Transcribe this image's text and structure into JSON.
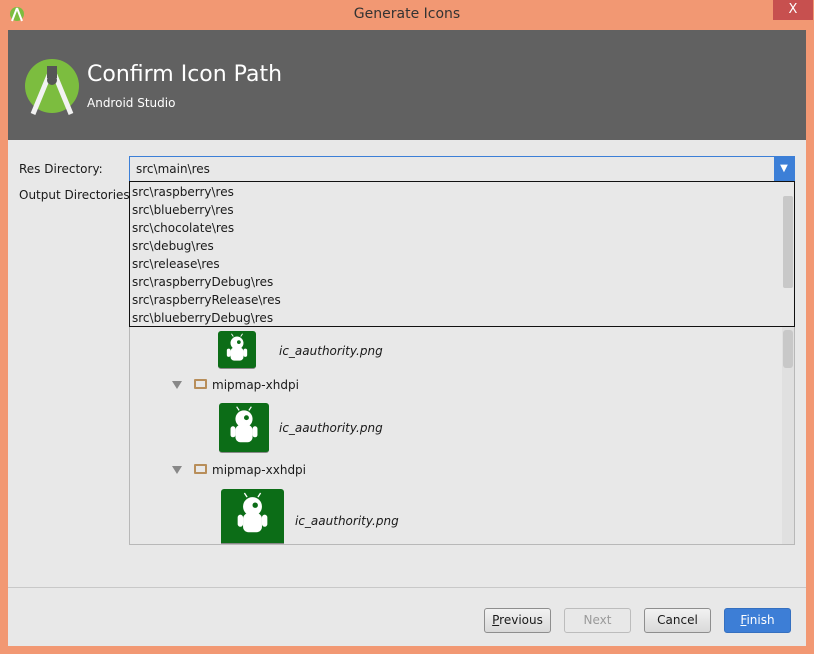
{
  "window": {
    "title": "Generate Icons",
    "close_label": "X"
  },
  "header": {
    "title": "Confirm Icon Path",
    "subtitle": "Android Studio"
  },
  "form": {
    "res_directory_label": "Res Directory:",
    "res_directory_value": "src\\main\\res",
    "output_directories_label": "Output Directories:"
  },
  "dropdown_options": [
    "src\\raspberry\\res",
    "src\\blueberry\\res",
    "src\\chocolate\\res",
    "src\\debug\\res",
    "src\\release\\res",
    "src\\raspberryDebug\\res",
    "src\\raspberryRelease\\res",
    "src\\blueberryDebug\\res"
  ],
  "tree": {
    "file1": "ic_aauthority.png",
    "folder_xhdpi": "mipmap-xhdpi",
    "file2": "ic_aauthority.png",
    "folder_xxhdpi": "mipmap-xxhdpi",
    "file3": "ic_aauthority.png"
  },
  "buttons": {
    "previous_u": "P",
    "previous_rest": "revious",
    "next": "Next",
    "cancel": "Cancel",
    "finish_u": "F",
    "finish_rest": "inish"
  },
  "colors": {
    "accent": "#3c7fd7",
    "titlebar": "#f29873",
    "header": "#616161",
    "icon_bg": "#0c6d17"
  }
}
